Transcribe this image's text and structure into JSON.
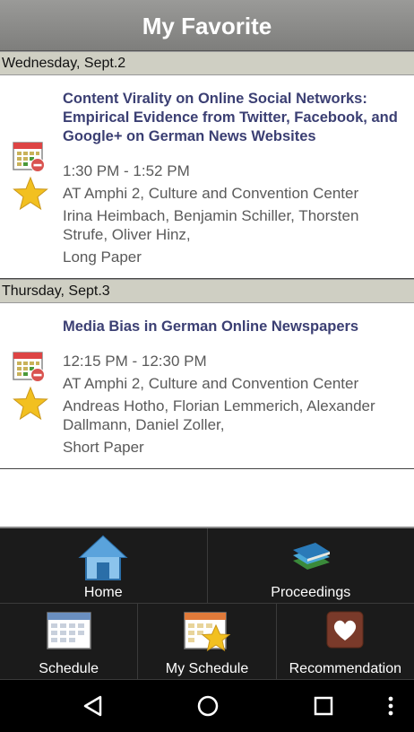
{
  "header": {
    "title": "My Favorite"
  },
  "days": [
    {
      "label": "Wednesday, Sept.2",
      "paper": {
        "title": "Content Virality on Online Social Networks: Empirical Evidence from Twitter, Facebook, and Google+ on German News Websites",
        "time": "1:30 PM - 1:52 PM",
        "location": "AT Amphi 2, Culture and Convention Center",
        "authors": "Irina Heimbach, Benjamin Schiller, Thorsten Strufe, Oliver Hinz,",
        "type": "Long Paper"
      }
    },
    {
      "label": "Thursday, Sept.3",
      "paper": {
        "title": "Media Bias in German Online Newspapers",
        "time": "12:15 PM - 12:30 PM",
        "location": "AT Amphi 2, Culture and Convention Center",
        "authors": "Andreas Hotho, Florian Lemmerich, Alexander Dallmann, Daniel Zoller,",
        "type": "Short Paper"
      }
    }
  ],
  "nav": {
    "home": "Home",
    "proceedings": "Proceedings",
    "schedule": "Schedule",
    "my_schedule": "My Schedule",
    "recommendation": "Recommendation"
  },
  "icons": {
    "remove_calendar": "calendar-remove-icon",
    "favorite": "star-icon",
    "back": "back-icon",
    "home": "home-circle-icon",
    "recents": "recents-icon",
    "more": "overflow-menu-icon"
  },
  "colors": {
    "title": "#3b3f73",
    "star": "#f2c020",
    "remove": "#d9534f"
  }
}
